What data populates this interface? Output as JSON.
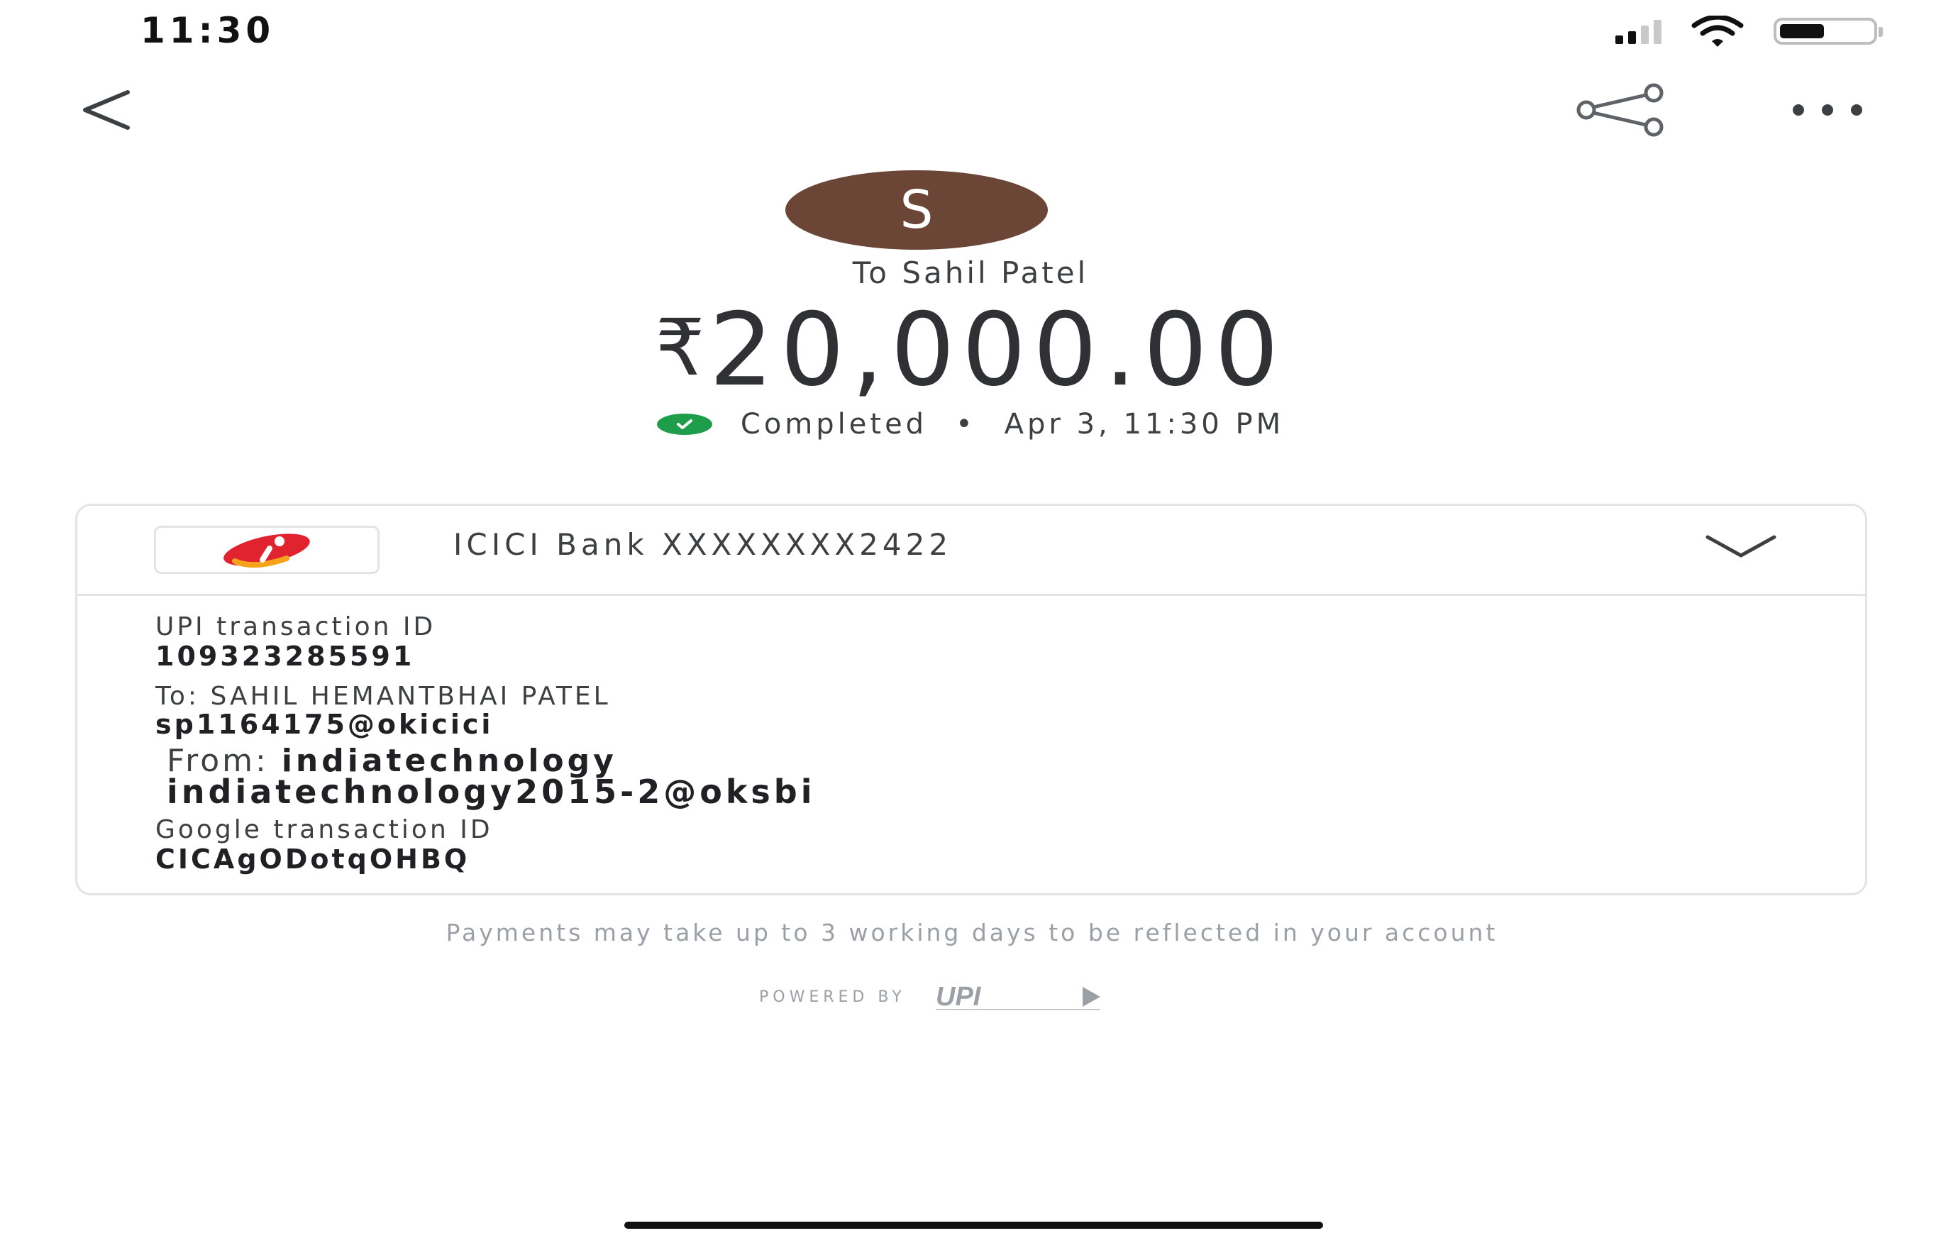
{
  "status_bar": {
    "time": "11:30"
  },
  "header": {
    "back_icon": "chevron-left-icon",
    "share_icon": "share-icon",
    "more_icon": "more-horizontal-icon"
  },
  "payee": {
    "avatar_letter": "S",
    "avatar_color": "#6b4637",
    "line": "To Sahil Patel"
  },
  "amount": {
    "currency": "₹",
    "value": "20,000.00"
  },
  "status": {
    "text": "Completed",
    "separator": "•",
    "datetime": "Apr 3, 11:30 PM",
    "color": "#1e9e4a"
  },
  "bank": {
    "name": "ICICI Bank XXXXXXXX2422",
    "logo_icon": "icici-logo"
  },
  "details": {
    "upi_label": "UPI transaction ID",
    "upi_value": "109323285591",
    "to_label": "To: SAHIL HEMANTBHAI PATEL",
    "to_value": "sp1164175@okicici",
    "from_prefix": "From:",
    "from_name": "indiatechnology",
    "from_value": "indiatechnology2015-2@oksbi",
    "google_label": "Google transaction ID",
    "google_value": "CICAgODotqOHBQ"
  },
  "footer": {
    "note": "Payments may take up to 3 working days to be reflected in your account",
    "powered_by": "POWERED BY",
    "upi_logo_text": "UPI"
  }
}
